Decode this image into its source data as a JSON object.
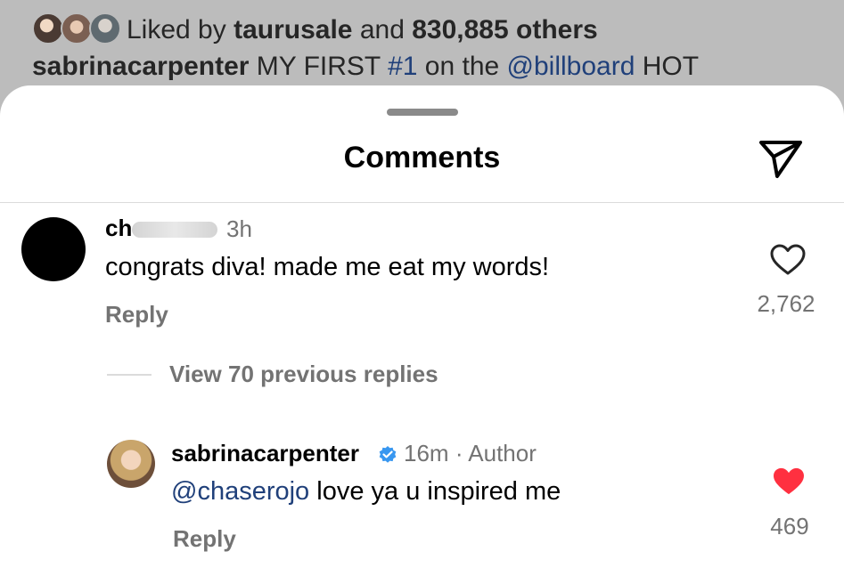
{
  "post": {
    "liked_prefix": "Liked by",
    "liked_user": "taurusale",
    "liked_and": "and",
    "liked_count": "830,885 others",
    "caption_user": "sabrinacarpenter",
    "caption_part1": "MY FIRST",
    "caption_hashtag": "#1",
    "caption_part2": "on the",
    "caption_mention": "@billboard",
    "caption_part3": "HOT"
  },
  "sheet": {
    "title": "Comments"
  },
  "comments": [
    {
      "username": "ch",
      "time": "3h",
      "text": "congrats diva! made me eat my words!",
      "reply_label": "Reply",
      "likes": "2,762",
      "liked": false
    }
  ],
  "replies": {
    "view_label": "View 70 previous replies",
    "items": [
      {
        "username": "sabrinacarpenter",
        "verified": true,
        "time": "16m",
        "separator": "·",
        "role": "Author",
        "mention": "@chaserojo",
        "text": "love ya u inspired me",
        "reply_label": "Reply",
        "likes": "469",
        "liked": true
      }
    ]
  },
  "icons": {
    "share": "paper-plane-icon",
    "like_empty": "heart-outline-icon",
    "like_filled": "heart-filled-icon",
    "verified": "verified-badge-icon"
  },
  "colors": {
    "link": "#20407a",
    "heart_red": "#ff3040",
    "verified_blue": "#3897f0",
    "muted": "#737373"
  }
}
